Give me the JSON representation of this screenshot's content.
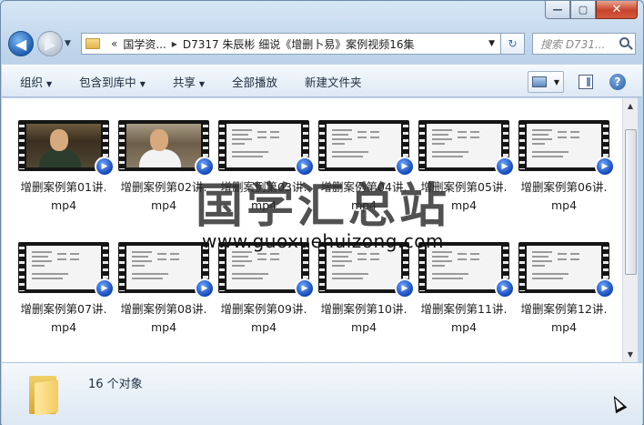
{
  "window": {
    "caption": {
      "minimize_glyph": "—",
      "maximize_glyph": "▢",
      "close_glyph": "✕"
    }
  },
  "nav": {
    "back_glyph": "◀",
    "forward_glyph": "▶",
    "history_caret": "▼",
    "address": {
      "overflow_glyph": "«",
      "crumbs": [
        "国学资...",
        "D7317 朱辰彬 细说《增删卜易》案例视频16集"
      ],
      "separator": "▸",
      "drop_caret": "▼"
    },
    "refresh_glyph": "↻",
    "search_placeholder": "搜索 D731..."
  },
  "toolbar": {
    "items": [
      {
        "label": "组织",
        "has_caret": true
      },
      {
        "label": "包含到库中",
        "has_caret": true
      },
      {
        "label": "共享",
        "has_caret": true
      },
      {
        "label": "全部播放",
        "has_caret": false
      },
      {
        "label": "新建文件夹",
        "has_caret": false
      }
    ],
    "caret": "▼",
    "help_glyph": "?"
  },
  "files": [
    {
      "name_line1": "增删案例第01讲.",
      "name_line2": "mp4",
      "thumb": "person"
    },
    {
      "name_line1": "增删案例第02讲.",
      "name_line2": "mp4",
      "thumb": "person2"
    },
    {
      "name_line1": "增删案例第03讲.",
      "name_line2": "mp4",
      "thumb": "doc"
    },
    {
      "name_line1": "增删案例第04讲.",
      "name_line2": "mp4",
      "thumb": "doc"
    },
    {
      "name_line1": "增删案例第05讲.",
      "name_line2": "mp4",
      "thumb": "doc"
    },
    {
      "name_line1": "增删案例第06讲.",
      "name_line2": "mp4",
      "thumb": "doc"
    },
    {
      "name_line1": "增删案例第07讲.",
      "name_line2": "mp4",
      "thumb": "doc"
    },
    {
      "name_line1": "增删案例第08讲.",
      "name_line2": "mp4",
      "thumb": "doc"
    },
    {
      "name_line1": "增删案例第09讲.",
      "name_line2": "mp4",
      "thumb": "doc"
    },
    {
      "name_line1": "增删案例第10讲.",
      "name_line2": "mp4",
      "thumb": "doc"
    },
    {
      "name_line1": "增删案例第11讲.",
      "name_line2": "mp4",
      "thumb": "doc"
    },
    {
      "name_line1": "增删案例第12讲.",
      "name_line2": "mp4",
      "thumb": "doc"
    }
  ],
  "scrollbar": {
    "up_glyph": "▲",
    "down_glyph": "▼"
  },
  "watermark": {
    "title": "国学汇总站",
    "url": "www.guoxuehuizong.com"
  },
  "details": {
    "object_count": "16 个对象"
  },
  "colors": {
    "accent": "#1f5fb0",
    "close_button": "#c7432b"
  }
}
